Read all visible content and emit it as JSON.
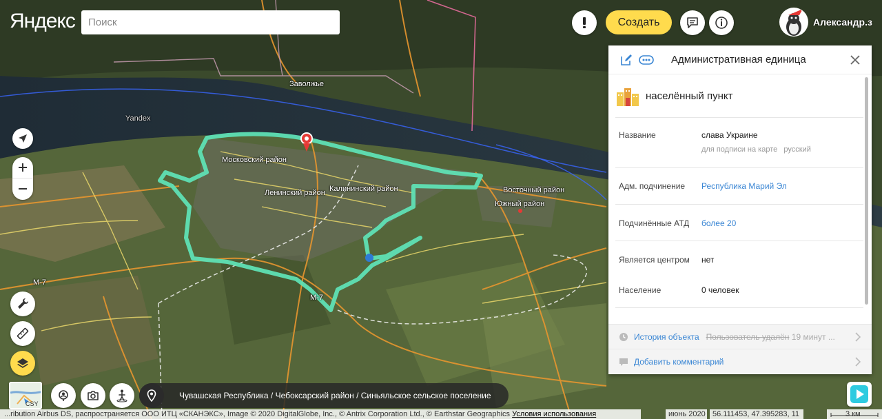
{
  "app": {
    "logo": "Яндекс",
    "search_placeholder": "Поиск",
    "create_label": "Создать",
    "user_name": "Александр.з"
  },
  "map_labels": {
    "zavolzhye": "Заволжье",
    "yandex_watermark": "Yandex",
    "moskovsky": "Московский район",
    "leninsky": "Ленинский район",
    "kalininsky": "Калининский район",
    "vostochny": "Восточный район",
    "yuzhny": "Южный район",
    "m7_a": "М-7",
    "m7_b": "М-7"
  },
  "minimap": {
    "label": "CSY"
  },
  "breadcrumb": "Чувашская Республика / Чебоксарский район / Синьяльское сельское поселение",
  "status": {
    "copyright_text": "...ribution Airbus DS, распространяется ООО ИТЦ «СКАНЭКС», Image © 2020 DigitalGlobe, Inc., © Antrix Corporation Ltd., © Earthstar Geographics",
    "terms_link": "Условия использования",
    "date": "июнь 2020",
    "coords": "56.111453, 47.395283, 11",
    "scale": "3 км"
  },
  "panel": {
    "title": "Административная единица",
    "type_label": "населённый пункт",
    "fields": {
      "name_label": "Название",
      "name_value": "слава Украине",
      "name_hint": "для подписи на карте",
      "name_lang": "русский",
      "subordination_label": "Адм. подчинение",
      "subordination_value": "Республика Марий Эл",
      "subordinate_label": "Подчинённые АТД",
      "subordinate_value": "более 20",
      "center_label": "Является центром",
      "center_value": "нет",
      "population_label": "Население",
      "population_value": "0 человек"
    },
    "history_link": "История объекта",
    "history_info": "Пользователь удалён",
    "history_time": "19 минут ...",
    "comment_link": "Добавить комментарий"
  },
  "colors": {
    "accent_yellow": "#ffdb4d",
    "boundary": "#5fe0b4",
    "link_blue": "#3a86d4"
  }
}
